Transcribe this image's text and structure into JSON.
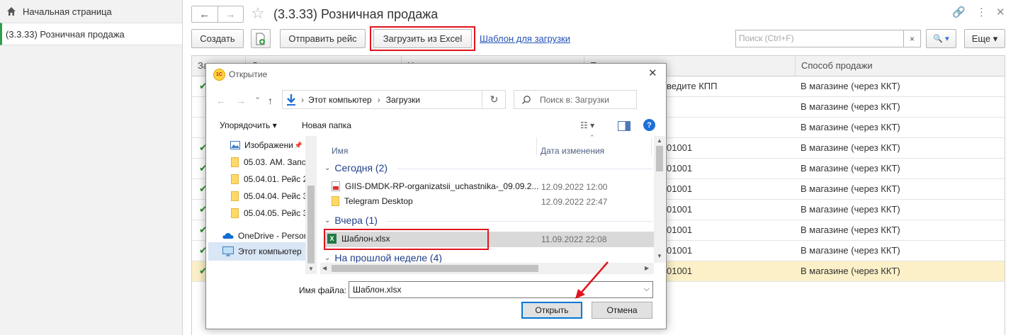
{
  "sidebar": {
    "home_label": "Начальная страница",
    "active_label": "(3.3.33) Розничная продажа"
  },
  "header": {
    "title": "(3.3.33) Розничная продажа",
    "back_glyph": "←",
    "forward_glyph": "→",
    "star_glyph": "☆",
    "link_glyph": "🔗",
    "more_glyph": "⋮",
    "close_glyph": "✕"
  },
  "toolbar": {
    "create_label": "Создать",
    "send_label": "Отправить рейс",
    "load_excel_label": "Загрузить из Excel",
    "template_link": "Шаблон для загрузки",
    "search_placeholder": "Поиск (Ctrl+F)",
    "search_clear": "×",
    "search_btn": "🔍 ▾",
    "more_label": "Еще ▾"
  },
  "table": {
    "col_partial_1": "За",
    "col_partial_2": "Д",
    "col_partial_3": "Н",
    "col_partial_4": "П",
    "col_sale": "Способ продажи",
    "check_glyph": "✔",
    "rows": [
      {
        "kpp": "ведите КПП",
        "sale": "В магазине (через ККТ)"
      },
      {
        "kpp": "",
        "sale": "В магазине (через ККТ)"
      },
      {
        "kpp": "",
        "sale": "В магазине (через ККТ)"
      },
      {
        "kpp": "01001",
        "sale": "В магазине (через ККТ)"
      },
      {
        "kpp": "01001",
        "sale": "В магазине (через ККТ)"
      },
      {
        "kpp": "01001",
        "sale": "В магазине (через ККТ)"
      },
      {
        "kpp": "01001",
        "sale": "В магазине (через ККТ)"
      },
      {
        "kpp": "01001",
        "sale": "В магазине (через ККТ)"
      },
      {
        "kpp": "01001",
        "sale": "В магазине (через ККТ)"
      },
      {
        "kpp": "01001",
        "sale": "В магазине (через ККТ)"
      }
    ]
  },
  "dialog": {
    "logo_text": "1С",
    "title": "Открытие",
    "close_glyph": "✕",
    "nav_arrows": [
      "←",
      "→",
      "⌄",
      "↑"
    ],
    "path": [
      "Этот компьютер",
      "Загрузки"
    ],
    "path_sep": "›",
    "refresh_glyph": "↻",
    "search_placeholder": "Поиск в: Загрузки",
    "organize_label": "Упорядочить ▾",
    "new_folder_label": "Новая папка",
    "view_glyph": "☷ ▾",
    "help_glyph": "?",
    "tree": [
      "Изображени",
      "05.03. АМ. Запо.",
      "05.04.01. Рейс 2.",
      "05.04.04. Рейс 3.",
      "05.04.05. Рейс 3.",
      "OneDrive - Persor",
      "Этот компьютер"
    ],
    "pin_glyph": "📌",
    "col_name": "Имя",
    "col_date": "Дата изменения",
    "groups": [
      "Сегодня (2)",
      "Вчера (1)",
      "На прошлой неделе (4)"
    ],
    "group_chevron": "⌄",
    "files": [
      {
        "name": "GIIS-DMDK-RP-organizatsii_uchastnika-_09.09.2...",
        "date": "12.09.2022 12:00"
      },
      {
        "name": "Telegram Desktop",
        "date": "12.09.2022 22:47"
      },
      {
        "name": "Шаблон.xlsx",
        "date": "11.09.2022 22:08"
      }
    ],
    "xls_glyph": "X",
    "filename_label": "Имя файла:",
    "filename_value": "Шаблон.xlsx",
    "open_label": "Открыть",
    "cancel_label": "Отмена"
  },
  "colors": {
    "highlight_red": "#e0141e",
    "link_blue": "#2450b8",
    "check_green": "#2e8b2e",
    "selected_row": "#fbf0c8",
    "active_nav_accent": "#2d9e4a"
  }
}
